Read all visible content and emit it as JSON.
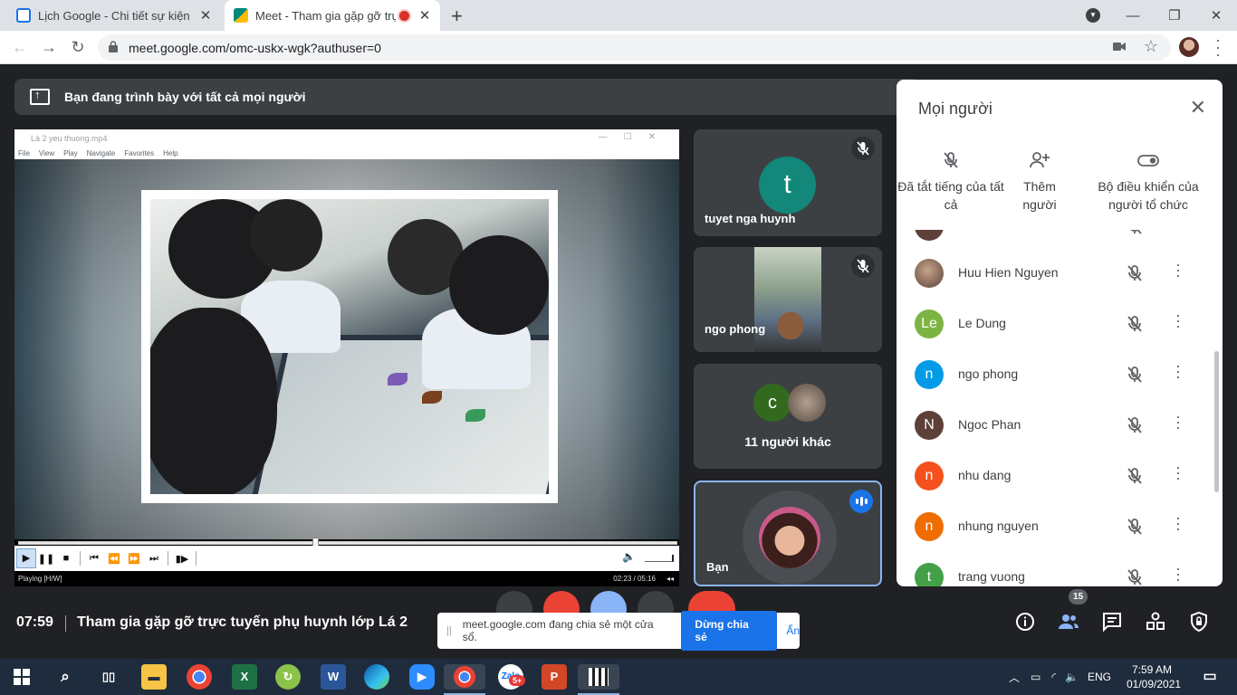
{
  "browser": {
    "tabs": [
      {
        "title": "Lịch Google - Chi tiết sự kiện",
        "state": "inactive",
        "favicon_color": "#1a73e8"
      },
      {
        "title": "Meet - Tham gia gặp gỡ trực",
        "state": "active",
        "favicon_color": "#00897b",
        "recording": true
      }
    ],
    "url": "meet.google.com/omc-uskx-wgk?authuser=0"
  },
  "meet": {
    "present_banner": "Bạn đang trình bày với tất cả mọi người",
    "player": {
      "window_title": "Lá 2 yeu thuong.mp4",
      "menu": [
        "File",
        "View",
        "Play",
        "Navigate",
        "Favorites",
        "Help"
      ],
      "status": "Playing [H/W]",
      "time": "02:23 / 05:16",
      "progress_fraction": 0.45
    },
    "tiles": [
      {
        "name": "tuyet nga huynh",
        "avatar_letter": "t",
        "avatar_color": "#12877a",
        "muted": true
      },
      {
        "name": "ngo phong",
        "camera": true,
        "muted": true
      },
      {
        "name": "11 người khác",
        "avatar_letter": "c",
        "avatar_color": "#33691e"
      },
      {
        "name": "Bạn",
        "speaking": true
      }
    ],
    "people_panel": {
      "title": "Mọi người",
      "actions": [
        {
          "label": "Đã tắt tiếng của tất cả",
          "icon": "mic-off-icon"
        },
        {
          "label": "Thêm người",
          "icon": "person-add-icon"
        },
        {
          "label": "Bộ điều khiển của người tổ chức",
          "icon": "toggle-icon"
        }
      ],
      "participants": [
        {
          "name": "Huu Hien Nguyen",
          "avatar_letter": "",
          "avatar_color": "#6d4c41"
        },
        {
          "name": "Le Dung",
          "avatar_letter": "Le",
          "avatar_color": "#7cb342"
        },
        {
          "name": "ngo phong",
          "avatar_letter": "n",
          "avatar_color": "#039be5"
        },
        {
          "name": "Ngoc Phan",
          "avatar_letter": "N",
          "avatar_color": "#5d4037"
        },
        {
          "name": "nhu dang",
          "avatar_letter": "n",
          "avatar_color": "#f4511e"
        },
        {
          "name": "nhung nguyen",
          "avatar_letter": "n",
          "avatar_color": "#ef6c00"
        },
        {
          "name": "trang vuong",
          "avatar_letter": "t",
          "avatar_color": "#43a047"
        }
      ]
    },
    "bottom": {
      "clock": "07:59",
      "meeting_title": "Tham gia gặp gỡ trực tuyến phụ huynh lớp Lá 2",
      "share_notice": "meet.google.com đang chia sẻ một cửa sổ.",
      "stop_share": "Dừng chia sẻ",
      "hide": "Ẩn",
      "people_count": "15"
    }
  },
  "taskbar": {
    "language": "ENG",
    "time": "7:59 AM",
    "date": "01/09/2021",
    "apps": [
      "file-explorer-icon",
      "chrome-icon",
      "excel-icon",
      "app-icon",
      "word-icon",
      "edge-icon",
      "zoom-icon",
      "chrome-icon",
      "zalo-icon",
      "powerpoint-icon",
      "video-editor-icon"
    ],
    "zalo_badge": "5+"
  }
}
